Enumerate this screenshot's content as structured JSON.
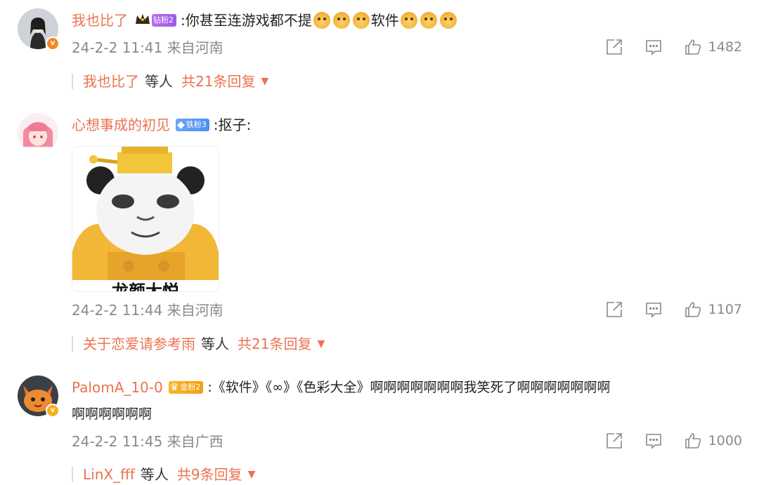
{
  "comments": [
    {
      "username": "我也比了",
      "fan_badge": "钻粉2",
      "content": ":你甚至连游戏都不提",
      "content_mid": "软件",
      "time_location": "24-2-2 11:41 来自河南",
      "likes": "1482",
      "replies": {
        "name": "我也比了",
        "etc": "等人",
        "total": "共21条回复"
      }
    },
    {
      "username": "心想事成的初见",
      "fan_badge": "铁粉3",
      "content": ":抠子:",
      "meme_caption": "龙颜大悦",
      "time_location": "24-2-2 11:44 来自河南",
      "likes": "1107",
      "replies": {
        "name": "关于恋爱请参考雨",
        "etc": "等人",
        "total": "共21条回复"
      }
    },
    {
      "username": "PalomA_10-0",
      "fan_badge": "金粉2",
      "content": ":《软件》《∞》《色彩大全》啊啊啊啊啊啊啊我笑死了啊啊啊啊啊啊啊",
      "content_line2": "啊啊啊啊啊啊",
      "time_location": "24-2-2 11:45 来自广西",
      "likes": "1000",
      "replies": {
        "name": "LinX_fff",
        "etc": "等人",
        "total": "共9条回复"
      }
    }
  ],
  "icons": {
    "share": "share-icon",
    "reply": "comment-icon",
    "like": "thumbs-up-icon",
    "emoji": "doge-emoji-icon",
    "crown": "crown-icon",
    "verified": "verified-v-icon",
    "caret": "caret-down-icon"
  },
  "colors": {
    "username": "#eb7350",
    "meta": "#8a8a8a",
    "text": "#222222"
  }
}
